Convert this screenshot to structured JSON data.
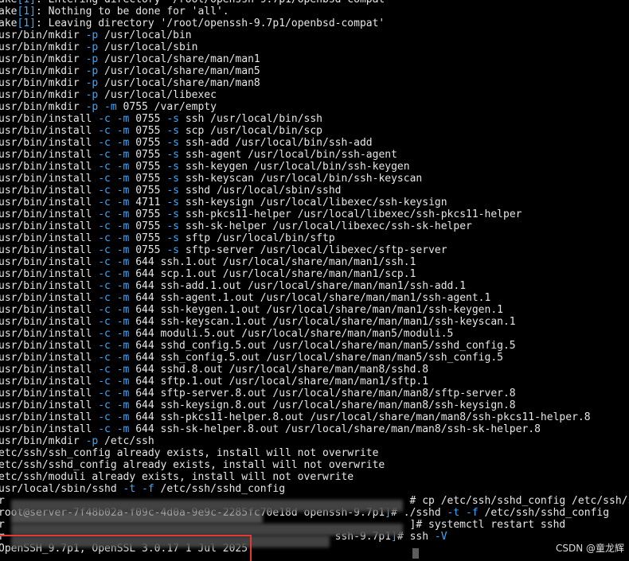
{
  "watermark": "CSDN @童龙辉",
  "colors": {
    "background": "#000000",
    "text": "#e6e6e6",
    "flag": "#3aa9ff",
    "highlight": "#e53935"
  },
  "lines": [
    [
      [
        "t",
        "ake"
      ],
      [
        "b",
        "[1]"
      ],
      [
        "t",
        ": Entering directory '/root/openssh-9.7p1/openbsd-compat'"
      ]
    ],
    [
      [
        "t",
        "ake"
      ],
      [
        "b",
        "[1]"
      ],
      [
        "t",
        ": Nothing to be done for 'all'."
      ]
    ],
    [
      [
        "t",
        "ake"
      ],
      [
        "b",
        "[1]"
      ],
      [
        "t",
        ": Leaving directory '/root/openssh-9.7p1/openbsd-compat'"
      ]
    ],
    [
      [
        "t",
        "usr/bin/mkdir "
      ],
      [
        "f",
        "-p"
      ],
      [
        "t",
        " /usr/local/bin"
      ]
    ],
    [
      [
        "t",
        "usr/bin/mkdir "
      ],
      [
        "f",
        "-p"
      ],
      [
        "t",
        " /usr/local/sbin"
      ]
    ],
    [
      [
        "t",
        "usr/bin/mkdir "
      ],
      [
        "f",
        "-p"
      ],
      [
        "t",
        " /usr/local/share/man/man1"
      ]
    ],
    [
      [
        "t",
        "usr/bin/mkdir "
      ],
      [
        "f",
        "-p"
      ],
      [
        "t",
        " /usr/local/share/man/man5"
      ]
    ],
    [
      [
        "t",
        "usr/bin/mkdir "
      ],
      [
        "f",
        "-p"
      ],
      [
        "t",
        " /usr/local/share/man/man8"
      ]
    ],
    [
      [
        "t",
        "usr/bin/mkdir "
      ],
      [
        "f",
        "-p"
      ],
      [
        "t",
        " /usr/local/libexec"
      ]
    ],
    [
      [
        "t",
        "usr/bin/mkdir "
      ],
      [
        "f",
        "-p -m"
      ],
      [
        "t",
        " 0755 /var/empty"
      ]
    ],
    [
      [
        "t",
        "usr/bin/install "
      ],
      [
        "f",
        "-c -m"
      ],
      [
        "t",
        " 0755 "
      ],
      [
        "f",
        "-s"
      ],
      [
        "t",
        " ssh /usr/local/bin/ssh"
      ]
    ],
    [
      [
        "t",
        "usr/bin/install "
      ],
      [
        "f",
        "-c -m"
      ],
      [
        "t",
        " 0755 "
      ],
      [
        "f",
        "-s"
      ],
      [
        "t",
        " scp /usr/local/bin/scp"
      ]
    ],
    [
      [
        "t",
        "usr/bin/install "
      ],
      [
        "f",
        "-c -m"
      ],
      [
        "t",
        " 0755 "
      ],
      [
        "f",
        "-s"
      ],
      [
        "t",
        " ssh-add /usr/local/bin/ssh-add"
      ]
    ],
    [
      [
        "t",
        "usr/bin/install "
      ],
      [
        "f",
        "-c -m"
      ],
      [
        "t",
        " 0755 "
      ],
      [
        "f",
        "-s"
      ],
      [
        "t",
        " ssh-agent /usr/local/bin/ssh-agent"
      ]
    ],
    [
      [
        "t",
        "usr/bin/install "
      ],
      [
        "f",
        "-c -m"
      ],
      [
        "t",
        " 0755 "
      ],
      [
        "f",
        "-s"
      ],
      [
        "t",
        " ssh-keygen /usr/local/bin/ssh-keygen"
      ]
    ],
    [
      [
        "t",
        "usr/bin/install "
      ],
      [
        "f",
        "-c -m"
      ],
      [
        "t",
        " 0755 "
      ],
      [
        "f",
        "-s"
      ],
      [
        "t",
        " ssh-keyscan /usr/local/bin/ssh-keyscan"
      ]
    ],
    [
      [
        "t",
        "usr/bin/install "
      ],
      [
        "f",
        "-c -m"
      ],
      [
        "t",
        " 0755 "
      ],
      [
        "f",
        "-s"
      ],
      [
        "t",
        " sshd /usr/local/sbin/sshd"
      ]
    ],
    [
      [
        "t",
        "usr/bin/install "
      ],
      [
        "f",
        "-c -m"
      ],
      [
        "t",
        " 4711 "
      ],
      [
        "f",
        "-s"
      ],
      [
        "t",
        " ssh-keysign /usr/local/libexec/ssh-keysign"
      ]
    ],
    [
      [
        "t",
        "usr/bin/install "
      ],
      [
        "f",
        "-c -m"
      ],
      [
        "t",
        " 0755 "
      ],
      [
        "f",
        "-s"
      ],
      [
        "t",
        " ssh-pkcs11-helper /usr/local/libexec/ssh-pkcs11-helper"
      ]
    ],
    [
      [
        "t",
        "usr/bin/install "
      ],
      [
        "f",
        "-c -m"
      ],
      [
        "t",
        " 0755 "
      ],
      [
        "f",
        "-s"
      ],
      [
        "t",
        " ssh-sk-helper /usr/local/libexec/ssh-sk-helper"
      ]
    ],
    [
      [
        "t",
        "usr/bin/install "
      ],
      [
        "f",
        "-c -m"
      ],
      [
        "t",
        " 0755 "
      ],
      [
        "f",
        "-s"
      ],
      [
        "t",
        " sftp /usr/local/bin/sftp"
      ]
    ],
    [
      [
        "t",
        "usr/bin/install "
      ],
      [
        "f",
        "-c -m"
      ],
      [
        "t",
        " 0755 "
      ],
      [
        "f",
        "-s"
      ],
      [
        "t",
        " sftp-server /usr/local/libexec/sftp-server"
      ]
    ],
    [
      [
        "t",
        "usr/bin/install "
      ],
      [
        "f",
        "-c -m"
      ],
      [
        "t",
        " 644 ssh.1.out /usr/local/share/man/man1/ssh.1"
      ]
    ],
    [
      [
        "t",
        "usr/bin/install "
      ],
      [
        "f",
        "-c -m"
      ],
      [
        "t",
        " 644 scp.1.out /usr/local/share/man/man1/scp.1"
      ]
    ],
    [
      [
        "t",
        "usr/bin/install "
      ],
      [
        "f",
        "-c -m"
      ],
      [
        "t",
        " 644 ssh-add.1.out /usr/local/share/man/man1/ssh-add.1"
      ]
    ],
    [
      [
        "t",
        "usr/bin/install "
      ],
      [
        "f",
        "-c -m"
      ],
      [
        "t",
        " 644 ssh-agent.1.out /usr/local/share/man/man1/ssh-agent.1"
      ]
    ],
    [
      [
        "t",
        "usr/bin/install "
      ],
      [
        "f",
        "-c -m"
      ],
      [
        "t",
        " 644 ssh-keygen.1.out /usr/local/share/man/man1/ssh-keygen.1"
      ]
    ],
    [
      [
        "t",
        "usr/bin/install "
      ],
      [
        "f",
        "-c -m"
      ],
      [
        "t",
        " 644 ssh-keyscan.1.out /usr/local/share/man/man1/ssh-keyscan.1"
      ]
    ],
    [
      [
        "t",
        "usr/bin/install "
      ],
      [
        "f",
        "-c -m"
      ],
      [
        "t",
        " 644 moduli.5.out /usr/local/share/man/man5/moduli.5"
      ]
    ],
    [
      [
        "t",
        "usr/bin/install "
      ],
      [
        "f",
        "-c -m"
      ],
      [
        "t",
        " 644 sshd_config.5.out /usr/local/share/man/man5/sshd_config.5"
      ]
    ],
    [
      [
        "t",
        "usr/bin/install "
      ],
      [
        "f",
        "-c -m"
      ],
      [
        "t",
        " 644 ssh_config.5.out /usr/local/share/man/man5/ssh_config.5"
      ]
    ],
    [
      [
        "t",
        "usr/bin/install "
      ],
      [
        "f",
        "-c -m"
      ],
      [
        "t",
        " 644 sshd.8.out /usr/local/share/man/man8/sshd.8"
      ]
    ],
    [
      [
        "t",
        "usr/bin/install "
      ],
      [
        "f",
        "-c -m"
      ],
      [
        "t",
        " 644 sftp.1.out /usr/local/share/man/man1/sftp.1"
      ]
    ],
    [
      [
        "t",
        "usr/bin/install "
      ],
      [
        "f",
        "-c -m"
      ],
      [
        "t",
        " 644 sftp-server.8.out /usr/local/share/man/man8/sftp-server.8"
      ]
    ],
    [
      [
        "t",
        "usr/bin/install "
      ],
      [
        "f",
        "-c -m"
      ],
      [
        "t",
        " 644 ssh-keysign.8.out /usr/local/share/man/man8/ssh-keysign.8"
      ]
    ],
    [
      [
        "t",
        "usr/bin/install "
      ],
      [
        "f",
        "-c -m"
      ],
      [
        "t",
        " 644 ssh-pkcs11-helper.8.out /usr/local/share/man/man8/ssh-pkcs11-helper.8"
      ]
    ],
    [
      [
        "t",
        "usr/bin/install "
      ],
      [
        "f",
        "-c -m"
      ],
      [
        "t",
        " 644 ssh-sk-helper.8.out /usr/local/share/man/man8/ssh-sk-helper.8"
      ]
    ],
    [
      [
        "t",
        "usr/bin/mkdir "
      ],
      [
        "f",
        "-p"
      ],
      [
        "t",
        " /etc/ssh"
      ]
    ],
    [
      [
        "t",
        "etc/ssh/ssh_config already exists, install will not overwrite"
      ]
    ],
    [
      [
        "t",
        "etc/ssh/sshd_config already exists, install will not overwrite"
      ]
    ],
    [
      [
        "t",
        "etc/ssh/moduli already exists, install will not overwrite"
      ]
    ],
    [
      [
        "t",
        "usr/local/sbin/sshd "
      ],
      [
        "f",
        "-t -f"
      ],
      [
        "t",
        " /etc/ssh/sshd_config"
      ]
    ],
    [
      [
        "t",
        "r                                                                 # cp /etc/ssh/sshd_config /etc/ssh/s"
      ]
    ],
    [
      [
        "t",
        "root@server-7f48b02a-f09c-4d0a-9e9c-2285fc70e18d openssh-9.7p1"
      ],
      [
        "b",
        "]"
      ],
      [
        "t",
        "# ./sshd "
      ],
      [
        "f",
        "-t -f"
      ],
      [
        "t",
        " /etc/ssh/sshd_config"
      ]
    ],
    [
      [
        "t",
        "r                                                                 ]# systemctl restart sshd"
      ]
    ],
    [
      [
        "t",
        "r                                                     ssh-9.7p1"
      ],
      [
        "b",
        "]"
      ],
      [
        "t",
        "# ssh "
      ],
      [
        "f",
        "-V"
      ]
    ],
    [
      [
        "t",
        "OpenSSH_9.7p1, OpenSSL 3.0.17 1 Jul 2025"
      ]
    ]
  ]
}
